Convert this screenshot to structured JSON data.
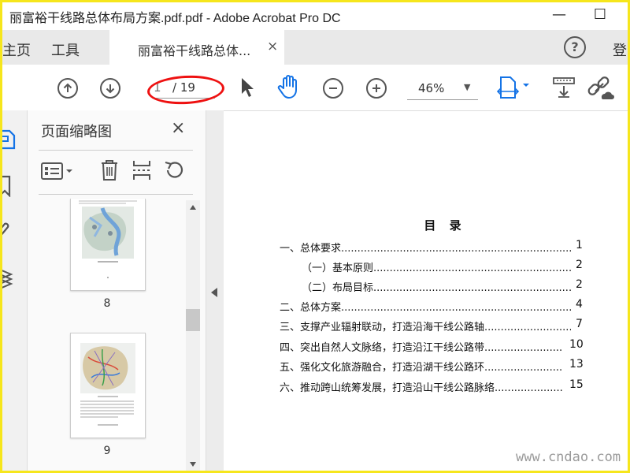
{
  "window": {
    "title": "丽富裕干线路总体布局方案.pdf.pdf - Adobe Acrobat Pro DC",
    "minimize": "—",
    "maximize": "☐"
  },
  "tabs": {
    "home": "主页",
    "tools": "工具",
    "doc_tab": "丽富裕干线路总体...",
    "doc_close": "×",
    "help": "?",
    "login": "登"
  },
  "toolbar": {
    "current_page": "1",
    "total_pages": "/ 19",
    "zoom": "46%"
  },
  "panel": {
    "title": "页面缩略图",
    "close": "×",
    "thumbnails": [
      {
        "label": "8"
      },
      {
        "label": "9"
      }
    ]
  },
  "toc": {
    "title": "目 录",
    "entries": [
      {
        "text": "一、总体要求.................................................................................",
        "page": "1"
      },
      {
        "text": "（一）基本原则.......................................................................",
        "page": "2"
      },
      {
        "text": "（二）布局目标.......................................................................",
        "page": "2"
      },
      {
        "text": "二、总体方案.................................................................................",
        "page": "4"
      },
      {
        "text": "三、支撑产业辐射联动，打造沿海干线公路轴............................",
        "page": "7"
      },
      {
        "text": "四、突出自然人文脉络，打造沿江干线公路带........................",
        "page": "10"
      },
      {
        "text": "五、强化文化旅游融合，打造沿湖干线公路环........................",
        "page": "13"
      },
      {
        "text": "六、推动跨山统筹发展，打造沿山干线公路脉络.....................",
        "page": "15"
      }
    ]
  },
  "watermark": "www.cndao.com",
  "colors": {
    "frame": "#f6e61c",
    "annotation": "#e11111",
    "active_tool": "#1473e6"
  }
}
